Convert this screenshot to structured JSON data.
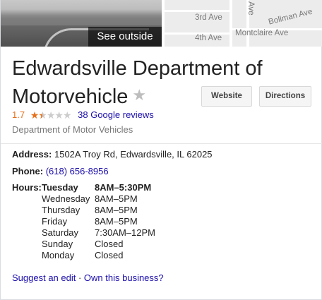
{
  "photo": {
    "see_outside_label": "See outside"
  },
  "map": {
    "labels": {
      "third_ave": "3rd Ave",
      "fourth_ave": "4th Ave",
      "bollman_ave": "Bollman Ave",
      "montclaire_ave": "Montclaire Ave",
      "vertical_ave": "Ave"
    }
  },
  "business": {
    "name": "Edwardsville Department of Motorvehicle",
    "rating": "1.7",
    "rating_value": 1.7,
    "rating_max": 5,
    "reviews_link": "38 Google reviews",
    "category": "Department of Motor Vehicles"
  },
  "actions": {
    "website_label": "Website",
    "directions_label": "Directions"
  },
  "address": {
    "label": "Address:",
    "value": "1502A Troy Rd, Edwardsville, IL 62025"
  },
  "phone": {
    "label": "Phone:",
    "value": "(618) 656-8956"
  },
  "hours": {
    "label": "Hours:",
    "rows": [
      {
        "day": "Tuesday",
        "time": "8AM–5:30PM"
      },
      {
        "day": "Wednesday",
        "time": "8AM–5PM"
      },
      {
        "day": "Thursday",
        "time": "8AM–5PM"
      },
      {
        "day": "Friday",
        "time": "8AM–5PM"
      },
      {
        "day": "Saturday",
        "time": "7:30AM–12PM"
      },
      {
        "day": "Sunday",
        "time": "Closed"
      },
      {
        "day": "Monday",
        "time": "Closed"
      }
    ]
  },
  "footer": {
    "suggest_edit": "Suggest an edit",
    "separator": " · ",
    "own_business": "Own this business?"
  },
  "colors": {
    "link": "#1a0dab",
    "rating_orange": "#e7711b",
    "muted": "#777777"
  }
}
